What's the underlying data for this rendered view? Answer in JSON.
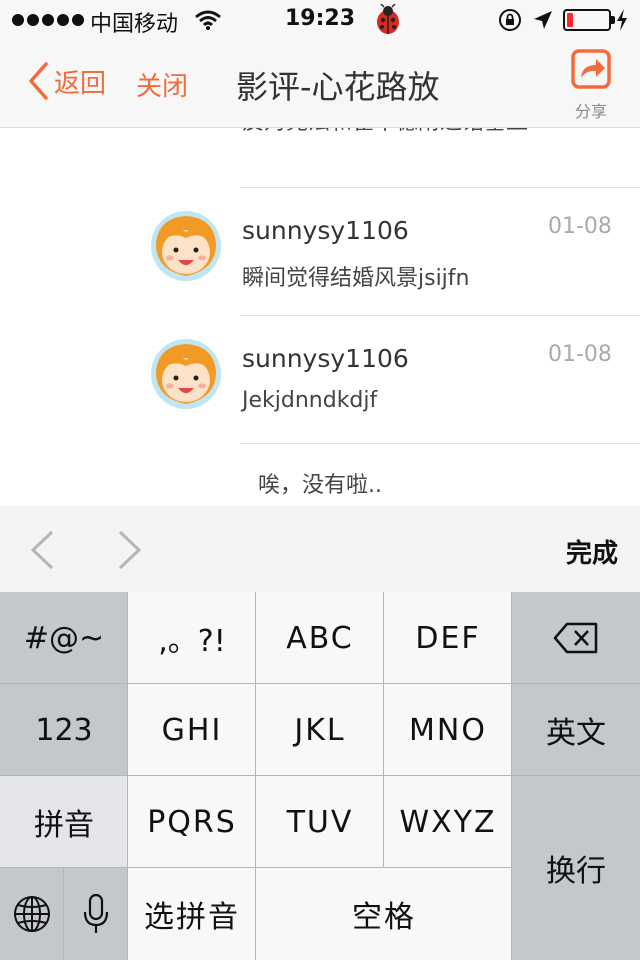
{
  "status_bar": {
    "carrier": "中国移动",
    "time": "19:23",
    "battery_level": 0.15
  },
  "nav": {
    "back_label": "返回",
    "close_label": "关闭",
    "title": "影评-心花路放",
    "share_label": "分享",
    "accent_color": "#f26b3a"
  },
  "comments": [
    {
      "name": "",
      "date": "",
      "text": "反对宪法和霍华德附近诺基亚"
    },
    {
      "name": "sunnysy1106",
      "date": "01-08",
      "text": "瞬间觉得结婚风景jsijfn"
    },
    {
      "name": "sunnysy1106",
      "date": "01-08",
      "text": "Jekjdnndkdjf"
    }
  ],
  "end_of_list": "唉，没有啦..",
  "accessory": {
    "done_label": "完成"
  },
  "keyboard": {
    "symbols": "#@~",
    "punct": ",。?!",
    "abc": "ABC",
    "def": "DEF",
    "num": "123",
    "ghi": "GHI",
    "jkl": "JKL",
    "mno": "MNO",
    "english": "英文",
    "pinyin": "拼音",
    "pqrs": "PQRS",
    "tuv": "TUV",
    "wxyz": "WXYZ",
    "enter": "换行",
    "select_pinyin": "选拼音",
    "space": "空格"
  }
}
